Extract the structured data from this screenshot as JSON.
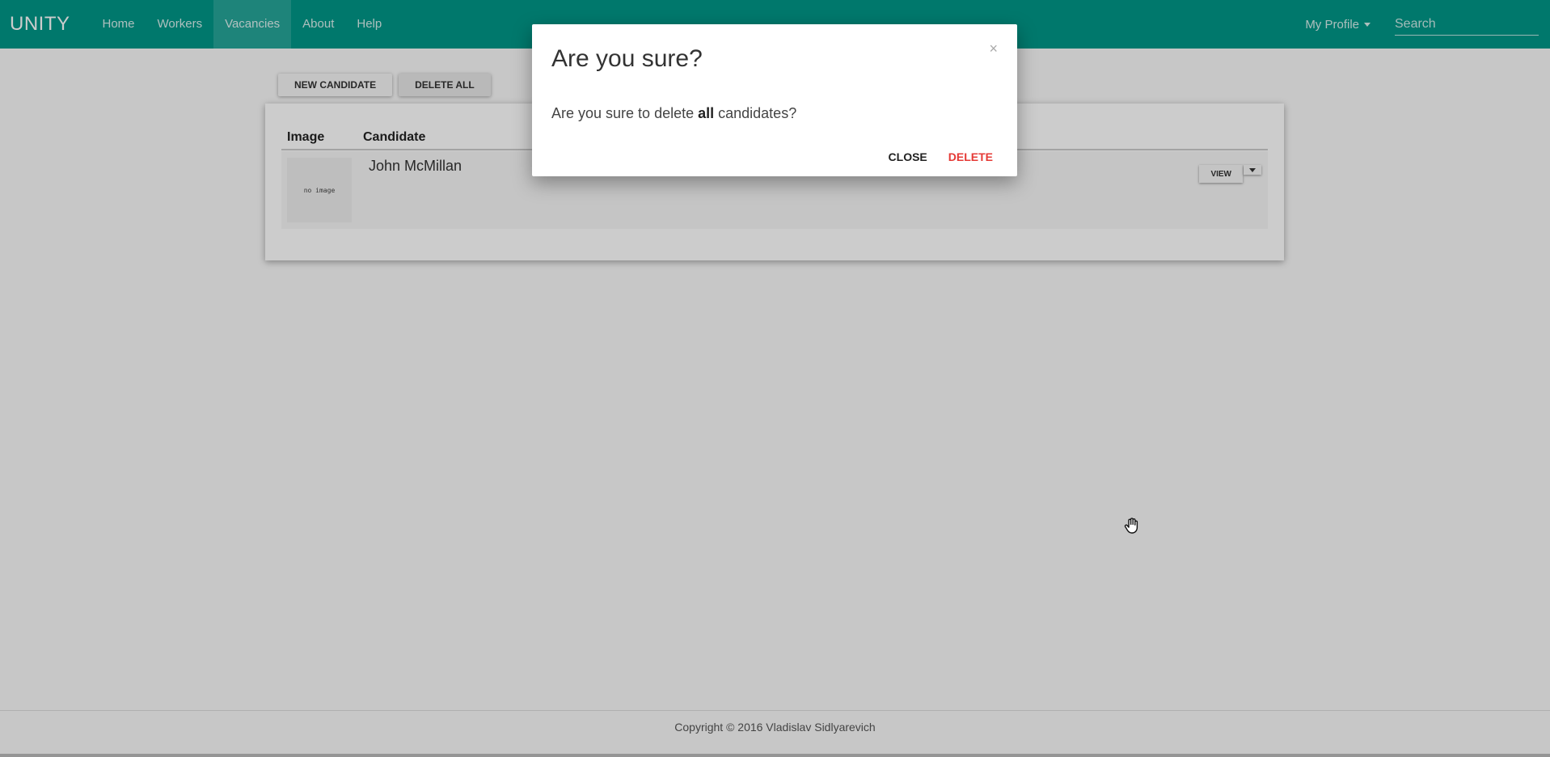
{
  "navbar": {
    "brand": "UNITY",
    "links": [
      "Home",
      "Workers",
      "Vacancies",
      "About",
      "Help"
    ],
    "active": "Vacancies",
    "profile_label": "My Profile",
    "search_placeholder": "Search"
  },
  "toolbar": {
    "new_candidate_label": "NEW CANDIDATE",
    "delete_all_label": "DELETE ALL"
  },
  "table": {
    "headers": [
      "Image",
      "Candidate"
    ],
    "rows": [
      {
        "image_label": "no image",
        "candidate": "John McMillan",
        "view_label": "VIEW"
      }
    ]
  },
  "modal": {
    "close_icon": "×",
    "title": "Are you sure?",
    "body_prefix": "Are you sure to delete ",
    "body_bold": "all",
    "body_suffix": " candidates?",
    "close_label": "CLOSE",
    "delete_label": "DELETE"
  },
  "footer": {
    "copyright": "Copyright © 2016 Vladislav Sidlyarevich"
  },
  "colors": {
    "primary": "#009688",
    "danger": "#e53935"
  }
}
